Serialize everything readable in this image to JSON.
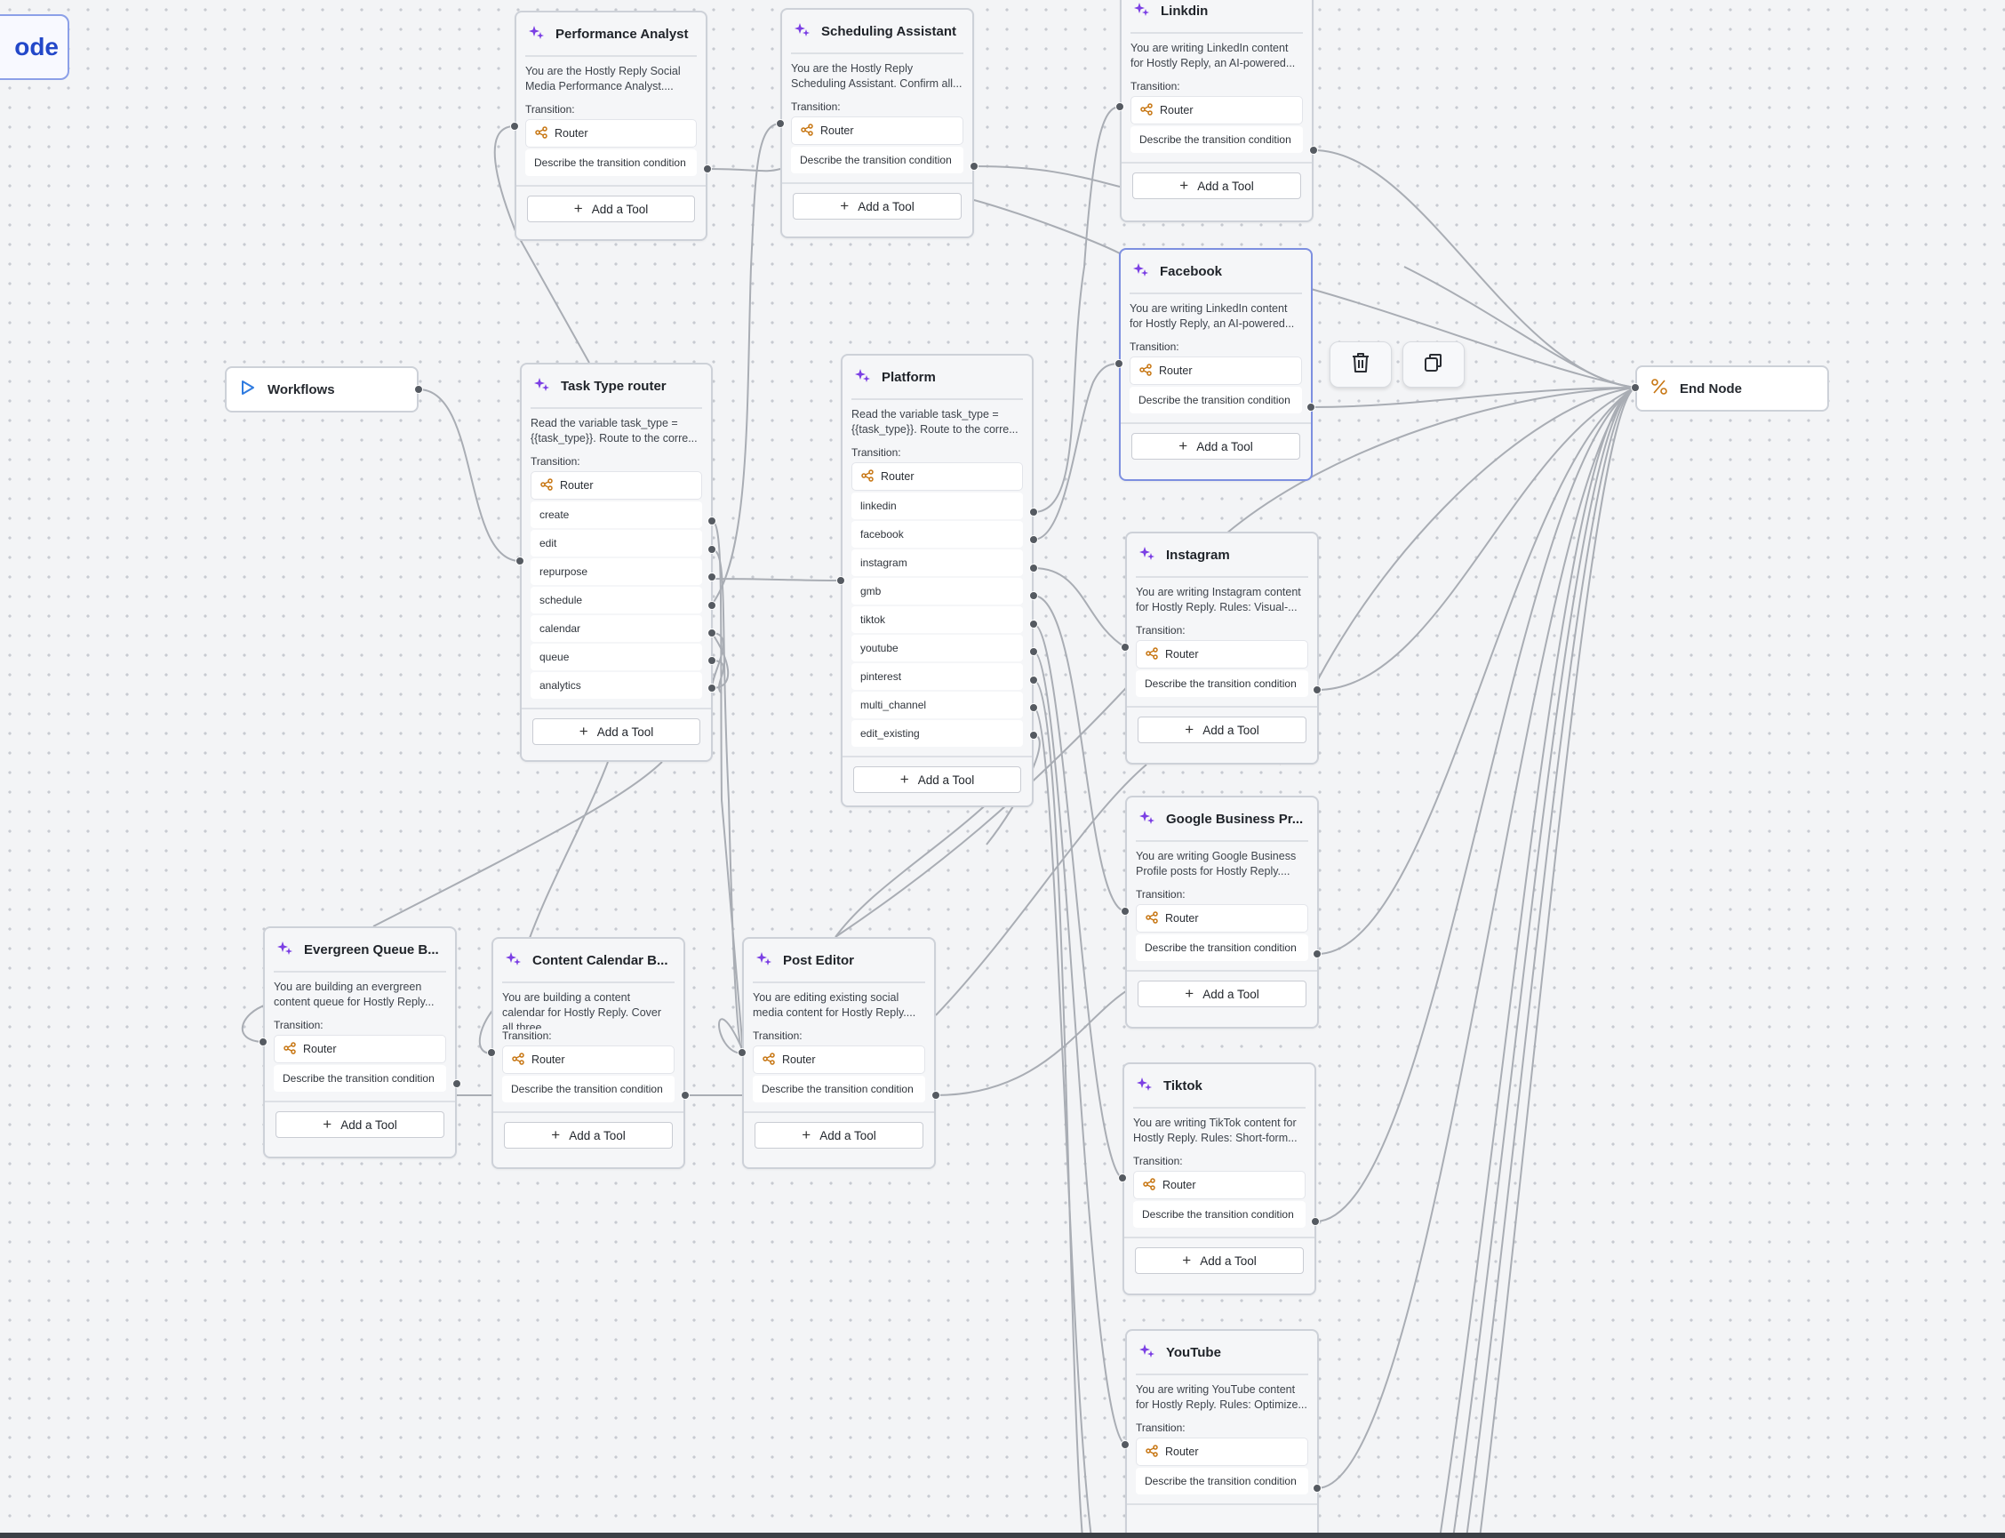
{
  "partial_node": {
    "text": "ode"
  },
  "start_node": {
    "title": "Workflows"
  },
  "end_node": {
    "title": "End Node"
  },
  "labels": {
    "transition": "Transition:",
    "router": "Router",
    "condition": "Describe the transition condition",
    "add_tool": "Add a Tool"
  },
  "action_toolbar": {
    "delete": "trash-icon",
    "duplicate": "copy-icon"
  },
  "nodes": [
    {
      "title": "Performance Analyst",
      "desc": "You are the Hostly Reply Social Media Performance Analyst...."
    },
    {
      "title": "Scheduling Assistant",
      "desc": "You are the Hostly Reply Scheduling Assistant. Confirm all..."
    },
    {
      "title": "Linkdin",
      "desc": "You are writing LinkedIn content for Hostly Reply, an AI-powered..."
    },
    {
      "title": "Facebook",
      "desc": "You are writing LinkedIn content for Hostly Reply, an AI-powered..."
    },
    {
      "title": "Task Type router",
      "desc": "Read the variable task_type = {{task_type}}. Route to the corre...",
      "routes": [
        "create",
        "edit",
        "repurpose",
        "schedule",
        "calendar",
        "queue",
        "analytics"
      ]
    },
    {
      "title": "Platform",
      "desc": "Read the variable task_type = {{task_type}}. Route to the corre...",
      "routes": [
        "linkedin",
        "facebook",
        "instagram",
        "gmb",
        "tiktok",
        "youtube",
        "pinterest",
        "multi_channel",
        "edit_existing"
      ]
    },
    {
      "title": "Instagram",
      "desc": "You are writing Instagram content for Hostly Reply. Rules: Visual-..."
    },
    {
      "title": "Google Business Pr...",
      "desc": "You are writing Google Business Profile posts for Hostly Reply...."
    },
    {
      "title": "Evergreen Queue B...",
      "desc": "You are building an evergreen content queue for Hostly Reply..."
    },
    {
      "title": "Content Calendar B...",
      "desc": "You are building a content calendar for Hostly Reply. Cover all three..."
    },
    {
      "title": "Post Editor",
      "desc": "You are editing existing social media content for Hostly Reply...."
    },
    {
      "title": "Tiktok",
      "desc": "You are writing TikTok content for Hostly Reply. Rules: Short-form..."
    },
    {
      "title": "YouTube",
      "desc": "You are writing YouTube content for Hostly Reply. Rules: Optimize..."
    }
  ]
}
